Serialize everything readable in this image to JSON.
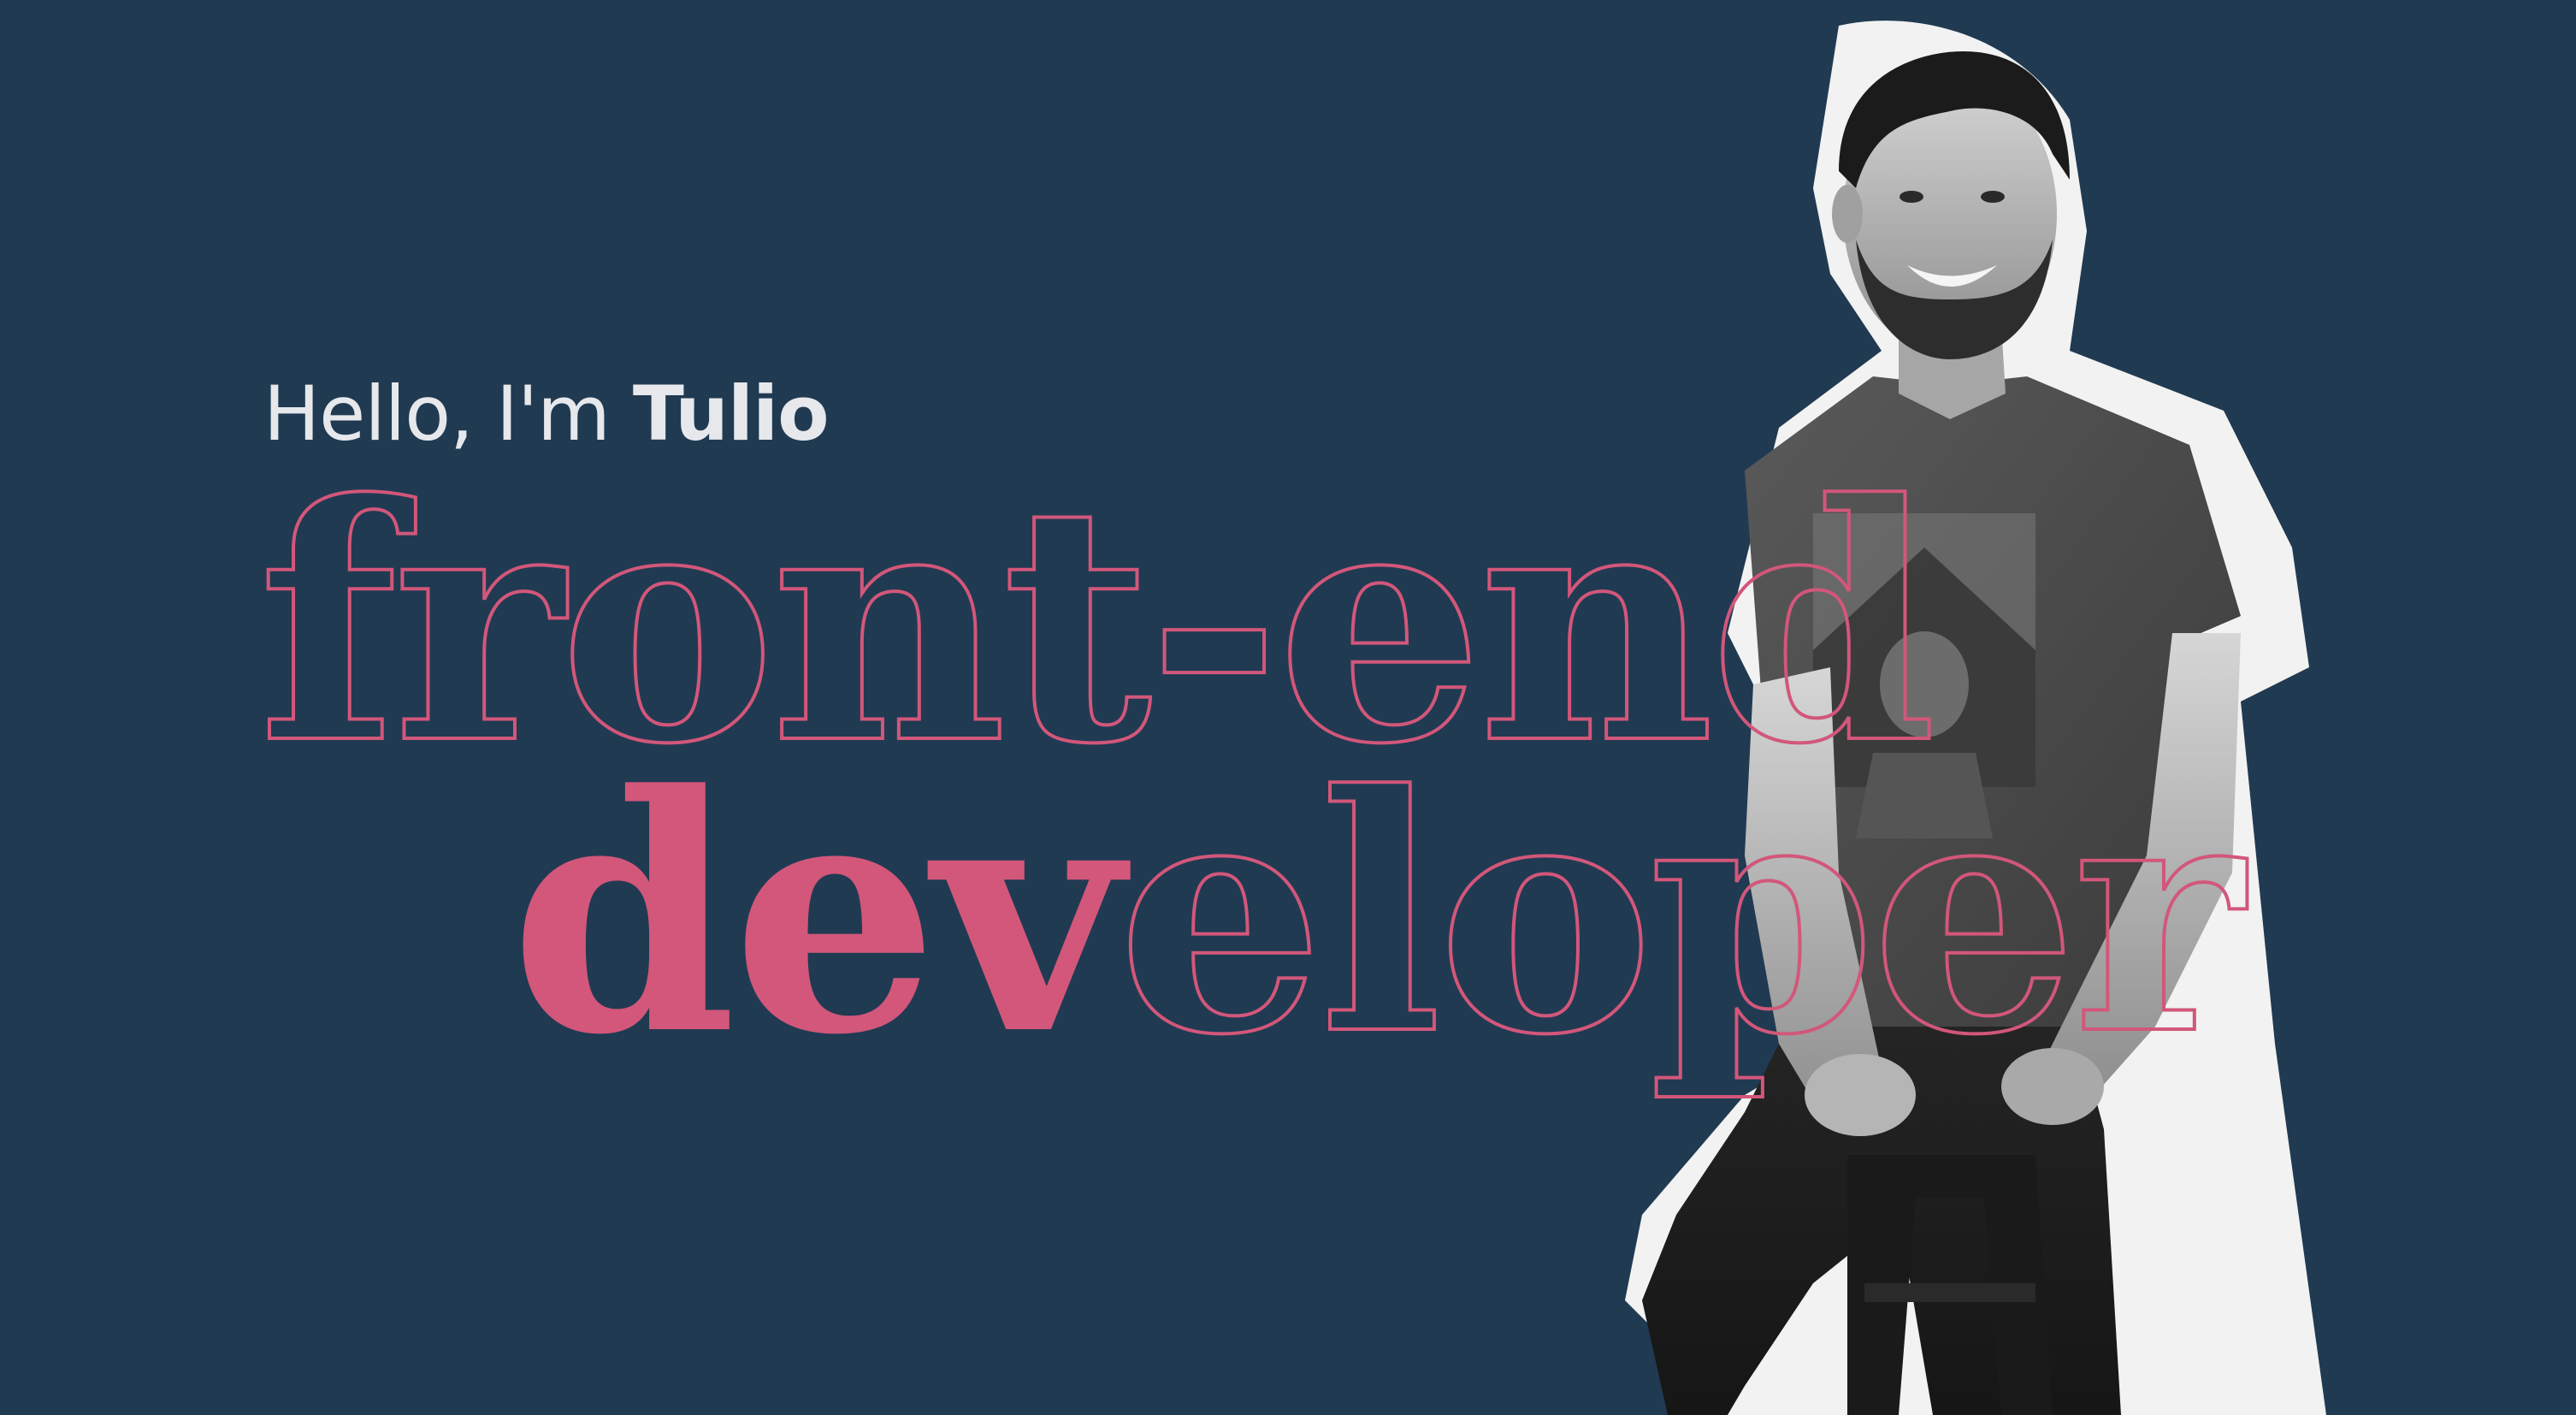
{
  "hero": {
    "greeting_prefix": "Hello, I'm ",
    "greeting_name": "Tulio",
    "title_line1": "front-end",
    "title_line2_highlight": "dev",
    "title_line2_rest": "eloper"
  },
  "colors": {
    "background": "#203a52",
    "accent": "#d2577a",
    "text": "#e6e8ec"
  },
  "photo": {
    "subject": "smiling-man-sitting-on-stool",
    "style": "black-and-white cutout with white border"
  }
}
